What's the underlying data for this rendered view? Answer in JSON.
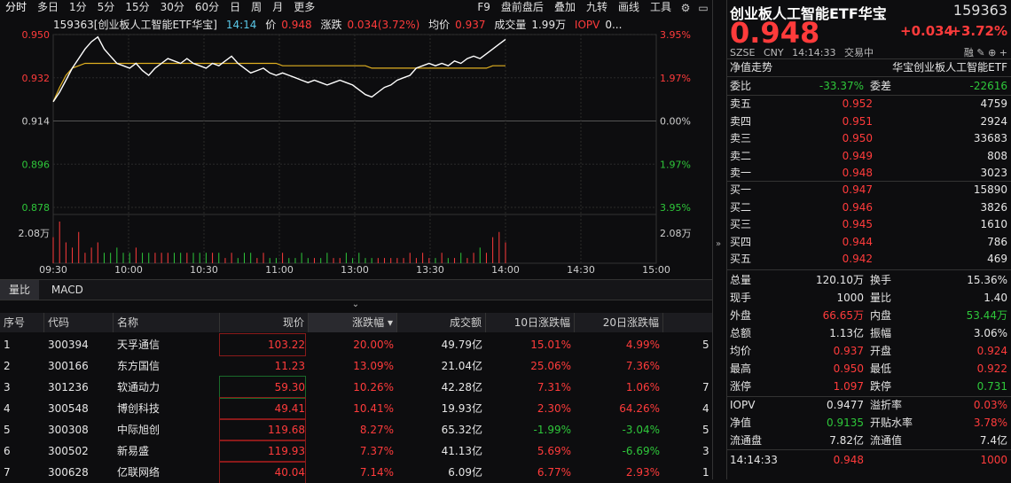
{
  "toolbar": {
    "left": [
      "分时",
      "多日",
      "1分",
      "5分",
      "15分",
      "30分",
      "60分",
      "日",
      "周",
      "月",
      "更多"
    ],
    "right": [
      "F9",
      "盘前盘后",
      "叠加",
      "九转",
      "画线",
      "工具"
    ]
  },
  "infobar": {
    "title": "159363[创业板人工智能ETF华宝]",
    "time": "14:14",
    "price_label": "价",
    "price": "0.948",
    "chg_label": "涨跌",
    "chg": "0.034(3.72%)",
    "avg_label": "均价",
    "avg": "0.937",
    "vol_label": "成交量",
    "vol": "1.99万",
    "iopv_label": "IOPV",
    "iopv": "0..."
  },
  "chart_data": {
    "type": "line",
    "y_left_ticks": [
      "0.950",
      "0.932",
      "0.914",
      "0.896",
      "0.878"
    ],
    "y_right_ticks": [
      "3.95%",
      "1.97%",
      "0.00%",
      "1.97%",
      "3.95%"
    ],
    "vol_tick": "2.08万",
    "x_ticks": [
      "09:30",
      "10:00",
      "10:30",
      "11:00",
      "13:00",
      "13:30",
      "14:00",
      "14:30",
      "15:00"
    ],
    "prev_close": 0.914,
    "ylim": [
      0.878,
      0.95
    ],
    "colors": {
      "price": "#ffffff",
      "avg": "#e0b020",
      "up": "#ff3b3b",
      "down": "#2ec73a"
    },
    "price_series": [
      0.922,
      0.926,
      0.931,
      0.936,
      0.94,
      0.944,
      0.947,
      0.949,
      0.944,
      0.941,
      0.938,
      0.937,
      0.936,
      0.938,
      0.935,
      0.933,
      0.936,
      0.938,
      0.94,
      0.939,
      0.938,
      0.94,
      0.938,
      0.937,
      0.936,
      0.938,
      0.937,
      0.939,
      0.941,
      0.938,
      0.936,
      0.934,
      0.935,
      0.936,
      0.934,
      0.933,
      0.934,
      0.933,
      0.932,
      0.931,
      0.93,
      0.931,
      0.93,
      0.929,
      0.93,
      0.931,
      0.93,
      0.929,
      0.927,
      0.925,
      0.924,
      0.926,
      0.928,
      0.929,
      0.931,
      0.932,
      0.933,
      0.936,
      0.937,
      0.938,
      0.937,
      0.938,
      0.937,
      0.939,
      0.938,
      0.94,
      0.941,
      0.94,
      0.942,
      0.944,
      0.946,
      0.948
    ],
    "avg_series": [
      0.922,
      0.928,
      0.933,
      0.936,
      0.937,
      0.938,
      0.938,
      0.938,
      0.938,
      0.938,
      0.938,
      0.938,
      0.938,
      0.938,
      0.938,
      0.938,
      0.938,
      0.938,
      0.938,
      0.938,
      0.938,
      0.938,
      0.938,
      0.938,
      0.938,
      0.938,
      0.938,
      0.938,
      0.938,
      0.938,
      0.938,
      0.938,
      0.938,
      0.938,
      0.938,
      0.938,
      0.937,
      0.937,
      0.937,
      0.937,
      0.937,
      0.937,
      0.937,
      0.937,
      0.937,
      0.937,
      0.937,
      0.937,
      0.937,
      0.937,
      0.936,
      0.936,
      0.936,
      0.936,
      0.936,
      0.936,
      0.936,
      0.936,
      0.936,
      0.936,
      0.936,
      0.936,
      0.936,
      0.936,
      0.936,
      0.936,
      0.936,
      0.936,
      0.936,
      0.937,
      0.937,
      0.937
    ],
    "volume_series": [
      5,
      8,
      4,
      3,
      6,
      2,
      3,
      4,
      2,
      2,
      3,
      2,
      2,
      3,
      2,
      2,
      2,
      2,
      2,
      2,
      2,
      2,
      2,
      2,
      2,
      2,
      2,
      1,
      2,
      1,
      2,
      2,
      1,
      2,
      1,
      1,
      2,
      1,
      1,
      2,
      1,
      1,
      1,
      2,
      1,
      1,
      2,
      1,
      2,
      1,
      1,
      1,
      1,
      1,
      1,
      1,
      2,
      1,
      2,
      1,
      1,
      2,
      1,
      1,
      2,
      1,
      2,
      3,
      2,
      5,
      6,
      4
    ]
  },
  "tabs": [
    "量比",
    "MACD"
  ],
  "table": {
    "headers": [
      "序号",
      "代码",
      "名称",
      "现价",
      "涨跌幅 ▾",
      "成交额",
      "10日涨跌幅",
      "20日涨跌幅"
    ],
    "rows": [
      {
        "idx": "1",
        "code": "300394",
        "name": "天孚通信",
        "price": "103.22",
        "chg": "20.00%",
        "amt": "49.79亿",
        "d10": "15.01%",
        "d20": "4.99%",
        "extra": "5"
      },
      {
        "idx": "2",
        "code": "300166",
        "name": "东方国信",
        "price": "11.23",
        "chg": "13.09%",
        "amt": "21.04亿",
        "d10": "25.06%",
        "d20": "7.36%",
        "extra": ""
      },
      {
        "idx": "3",
        "code": "301236",
        "name": "软通动力",
        "price": "59.30",
        "chg": "10.26%",
        "amt": "42.28亿",
        "d10": "7.31%",
        "d20": "1.06%",
        "extra": "7"
      },
      {
        "idx": "4",
        "code": "300548",
        "name": "博创科技",
        "price": "49.41",
        "chg": "10.41%",
        "amt": "19.93亿",
        "d10": "2.30%",
        "d20": "64.26%",
        "extra": "4"
      },
      {
        "idx": "5",
        "code": "300308",
        "name": "中际旭创",
        "price": "119.68",
        "chg": "8.27%",
        "amt": "65.32亿",
        "d10": "-1.99%",
        "d20": "-3.04%",
        "extra": "5"
      },
      {
        "idx": "6",
        "code": "300502",
        "name": "新易盛",
        "price": "119.93",
        "chg": "7.37%",
        "amt": "41.13亿",
        "d10": "5.69%",
        "d20": "-6.69%",
        "extra": "3"
      },
      {
        "idx": "7",
        "code": "300628",
        "name": "亿联网络",
        "price": "40.04",
        "chg": "7.14%",
        "amt": "6.09亿",
        "d10": "6.77%",
        "d20": "2.93%",
        "extra": "1"
      }
    ]
  },
  "panel": {
    "title": "创业板人工智能ETF华宝",
    "code": "159363",
    "price": "0.948",
    "chg": "+0.034",
    "pct": "+3.72%",
    "meta": [
      "SZSE",
      "CNY",
      "14:14:33",
      "交易中"
    ],
    "meta_icons": "融 ✎ ⊕ +",
    "nav_label": "净值走势",
    "nav_name": "华宝创业板人工智能ETF",
    "weibi_label": "委比",
    "weibi": "-33.37%",
    "weicha_label": "委差",
    "weicha": "-22616",
    "asks": [
      {
        "label": "卖五",
        "price": "0.952",
        "vol": "4759"
      },
      {
        "label": "卖四",
        "price": "0.951",
        "vol": "2924"
      },
      {
        "label": "卖三",
        "price": "0.950",
        "vol": "33683"
      },
      {
        "label": "卖二",
        "price": "0.949",
        "vol": "808"
      },
      {
        "label": "卖一",
        "price": "0.948",
        "vol": "3023"
      }
    ],
    "bids": [
      {
        "label": "买一",
        "price": "0.947",
        "vol": "15890"
      },
      {
        "label": "买二",
        "price": "0.946",
        "vol": "3826"
      },
      {
        "label": "买三",
        "price": "0.945",
        "vol": "1610"
      },
      {
        "label": "买四",
        "price": "0.944",
        "vol": "786"
      },
      {
        "label": "买五",
        "price": "0.942",
        "vol": "469"
      }
    ],
    "stats": [
      {
        "a": "总量",
        "b": "120.10万",
        "bc": "white",
        "c": "换手",
        "d": "15.36%",
        "dc": "white"
      },
      {
        "a": "现手",
        "b": "1000",
        "bc": "white",
        "c": "量比",
        "d": "1.40",
        "dc": "white"
      },
      {
        "a": "外盘",
        "b": "66.65万",
        "bc": "red",
        "c": "内盘",
        "d": "53.44万",
        "dc": "green"
      },
      {
        "a": "总额",
        "b": "1.13亿",
        "bc": "white",
        "c": "振幅",
        "d": "3.06%",
        "dc": "white"
      },
      {
        "a": "均价",
        "b": "0.937",
        "bc": "red",
        "c": "开盘",
        "d": "0.924",
        "dc": "red"
      },
      {
        "a": "最高",
        "b": "0.950",
        "bc": "red",
        "c": "最低",
        "d": "0.922",
        "dc": "red"
      },
      {
        "a": "涨停",
        "b": "1.097",
        "bc": "red",
        "c": "跌停",
        "d": "0.731",
        "dc": "green"
      }
    ],
    "stats2": [
      {
        "a": "IOPV",
        "b": "0.9477",
        "bc": "white",
        "c": "溢折率",
        "d": "0.03%",
        "dc": "red"
      },
      {
        "a": "净值",
        "b": "0.9135",
        "bc": "green",
        "c": "开贴水率",
        "d": "3.78%",
        "dc": "red"
      },
      {
        "a": "流通盘",
        "b": "7.82亿",
        "bc": "white",
        "c": "流通值",
        "d": "7.4亿",
        "dc": "white"
      }
    ],
    "tick": {
      "time": "14:14:33",
      "price": "0.948",
      "vol": "1000"
    }
  }
}
